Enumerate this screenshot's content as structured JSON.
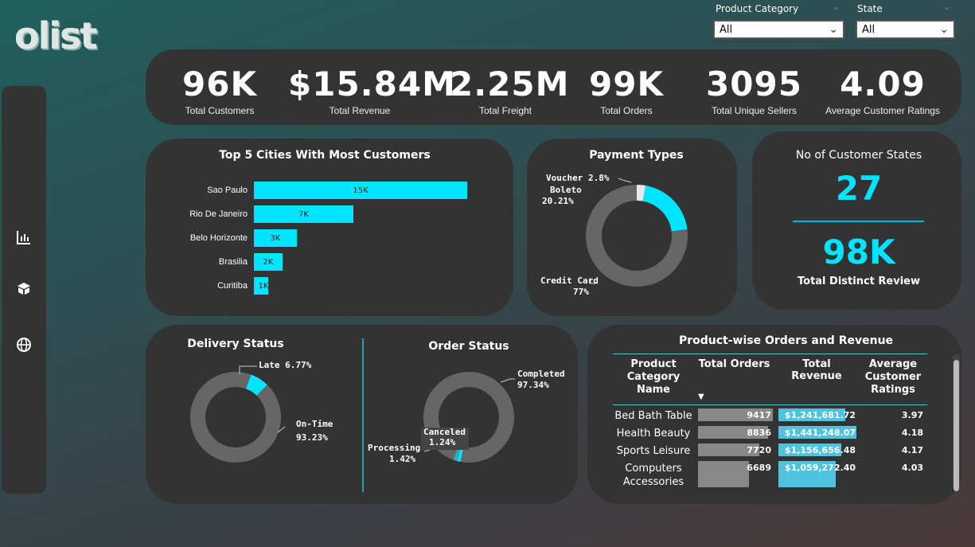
{
  "logo": "olist",
  "slicers": [
    {
      "label": "Product Category",
      "value": "All"
    },
    {
      "label": "State",
      "value": "All"
    }
  ],
  "sidebar": [
    {
      "icon": "bar-chart-icon"
    },
    {
      "icon": "box-icon"
    },
    {
      "icon": "globe-icon"
    }
  ],
  "kpis": [
    {
      "value": "96K",
      "label": "Total Customers"
    },
    {
      "value": "$15.84M",
      "label": "Total Revenue"
    },
    {
      "value": "2.25M",
      "label": "Total Freight"
    },
    {
      "value": "99K",
      "label": "Total Orders"
    },
    {
      "value": "3095",
      "label": "Total Unique Sellers"
    },
    {
      "value": "4.09",
      "label": "Average Customer Ratings"
    }
  ],
  "cities": {
    "title": "Top 5 Cities With Most Customers",
    "chart_data": {
      "type": "bar",
      "categories": [
        "Sao Paulo",
        "Rio De Janeiro",
        "Belo Horizonte",
        "Brasilia",
        "Curitiba"
      ],
      "values": [
        15,
        7,
        3,
        2,
        1
      ],
      "labels": [
        "15K",
        "7K",
        "3K",
        "2K",
        "1K"
      ],
      "color": "#00e5ff"
    }
  },
  "payment": {
    "title": "Payment Types",
    "chart_data": {
      "type": "pie",
      "categories": [
        "Voucher",
        "Boleto",
        "Credit Card"
      ],
      "values": [
        2.8,
        20.21,
        77
      ],
      "colors": [
        "#e8e8e8",
        "#00e5ff",
        "#666666"
      ]
    },
    "labels": [
      "Voucher 2.8%",
      "Boleto",
      "20.21%",
      "Credit Card",
      "77%"
    ]
  },
  "states": {
    "title": "No of Customer States",
    "value": "27",
    "review_value": "98K",
    "review_label": "Total Distinct Review"
  },
  "delivery": {
    "title": "Delivery Status",
    "chart_data": {
      "type": "pie",
      "categories": [
        "Late",
        "On-Time"
      ],
      "values": [
        6.77,
        93.23
      ],
      "colors": [
        "#00e5ff",
        "#666666"
      ]
    },
    "labels": [
      "Late 6.77%",
      "On-Time",
      "93.23%"
    ]
  },
  "order": {
    "title": "Order Status",
    "chart_data": {
      "type": "pie",
      "categories": [
        "Completed",
        "Canceled",
        "Processing"
      ],
      "values": [
        97.34,
        1.24,
        1.42
      ],
      "colors": [
        "#666666",
        "#00e5ff",
        "#3aa6b8"
      ]
    },
    "labels": [
      "Completed",
      "97.34%",
      "Canceled",
      "1.24%",
      "Processing",
      "1.42%"
    ]
  },
  "products": {
    "title": "Product-wise Orders and Revenue",
    "headers": [
      "Product Category Name",
      "Total Orders",
      "Total Revenue",
      "Average Customer Ratings"
    ],
    "rows": [
      {
        "name": "Bed Bath Table",
        "orders": 9417,
        "orders_label": "9417",
        "revenue": 1241681.72,
        "revenue_label": "$1,241,681.72",
        "rating": "3.97"
      },
      {
        "name": "Health Beauty",
        "orders": 8836,
        "orders_label": "8836",
        "revenue": 1441248.07,
        "revenue_label": "$1,441,248.07",
        "rating": "4.18"
      },
      {
        "name": "Sports Leisure",
        "orders": 7720,
        "orders_label": "7720",
        "revenue": 1156656.48,
        "revenue_label": "$1,156,656.48",
        "rating": "4.17"
      },
      {
        "name": "Computers Accessories",
        "orders": 6689,
        "orders_label": "6689",
        "revenue": 1059272.4,
        "revenue_label": "$1,059,272.40",
        "rating": "4.03"
      }
    ],
    "orders_color": "#888888",
    "revenue_color": "#4fc3dd"
  }
}
